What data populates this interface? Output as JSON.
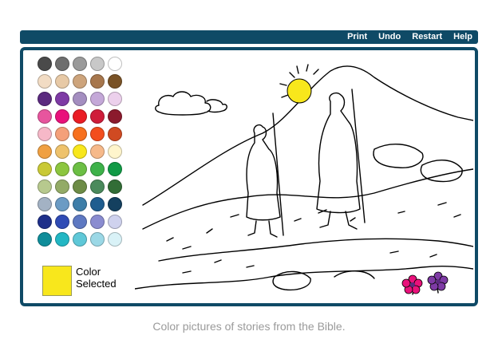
{
  "menu": {
    "print": "Print",
    "undo": "Undo",
    "restart": "Restart",
    "help": "Help"
  },
  "palette": {
    "colors": [
      "#4a4a4a",
      "#6e6e6e",
      "#9a9a9a",
      "#c8c8c8",
      "#ffffff",
      "#f2dcc4",
      "#e7c9a6",
      "#cda47c",
      "#a7774d",
      "#7a5327",
      "#5b2a7f",
      "#7e3aa5",
      "#a48ec0",
      "#c4a8d8",
      "#ecd0ec",
      "#e7559e",
      "#e9117b",
      "#ea1c24",
      "#cf1c3a",
      "#8b1a2d",
      "#f6b8c8",
      "#f4a07a",
      "#f7701e",
      "#f34e1e",
      "#d04a22",
      "#f0a042",
      "#eec26c",
      "#f8e71c",
      "#f6b98a",
      "#fff5cc",
      "#c9c935",
      "#8cc63f",
      "#6cbf44",
      "#3db24a",
      "#109a45",
      "#b7c98e",
      "#93ab67",
      "#6d8c46",
      "#4a8a5c",
      "#326d36",
      "#a3b2c4",
      "#6b9bc4",
      "#3e7ea8",
      "#1f5d8f",
      "#14405f",
      "#1e2f8a",
      "#2f4bb5",
      "#5e79c2",
      "#8a8cd0",
      "#cfd2ee",
      "#0f8d9a",
      "#22b7c4",
      "#5fc8d8",
      "#9bd8e6",
      "#d9f2f7"
    ],
    "selected_color": "#f8e71c",
    "selected_label_line1": "Color",
    "selected_label_line2": "Selected"
  },
  "caption": "Color pictures of stories from the Bible."
}
